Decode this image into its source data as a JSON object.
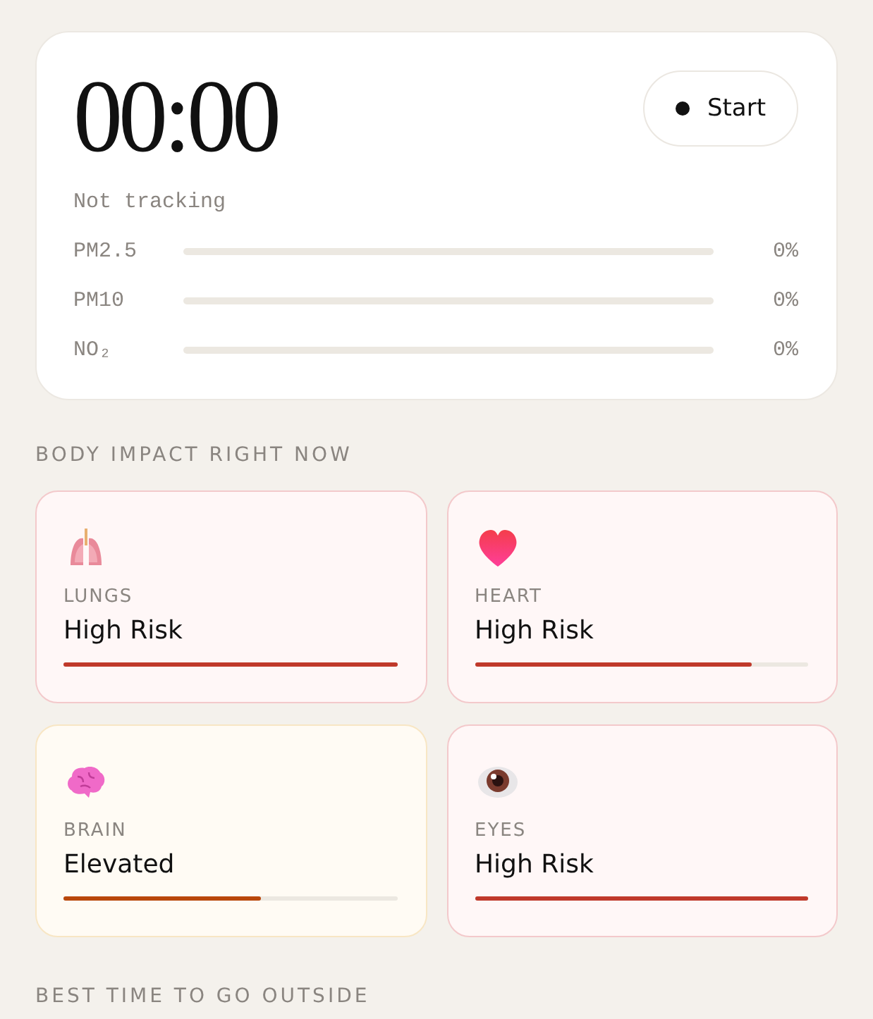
{
  "timer": {
    "time": "00:00",
    "status": "Not tracking",
    "button": {
      "label": "Start"
    },
    "pollutants": [
      {
        "name": "PM2.5",
        "reading": "0%"
      },
      {
        "name": "PM10",
        "reading": "0%"
      },
      {
        "name": "NO₂",
        "reading": "0%"
      }
    ]
  },
  "body_impact": {
    "heading": "BODY IMPACT RIGHT NOW",
    "organs": [
      {
        "kind": "lungs",
        "name": "LUNGS",
        "status": "High Risk",
        "color": "#c0392b",
        "level": 1
      },
      {
        "kind": "heart",
        "name": "HEART",
        "status": "High Risk",
        "color": "#c0392b",
        "level": 0.83
      },
      {
        "kind": "brain",
        "name": "BRAIN",
        "status": "Elevated",
        "color": "#b9470b",
        "level": 0.59
      },
      {
        "kind": "eyes",
        "name": "EYES",
        "status": "High Risk",
        "color": "#c0392b",
        "level": 1
      }
    ]
  },
  "next_section": {
    "heading": "BEST TIME TO GO OUTSIDE"
  }
}
